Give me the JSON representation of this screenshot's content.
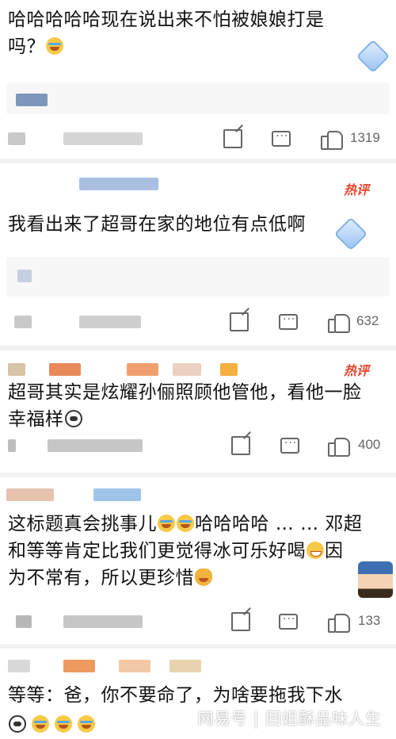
{
  "comments": [
    {
      "text": "哈哈哈哈哈现在说出来不怕被娘娘打是吗？",
      "likes": "1319",
      "hot_badge": ""
    },
    {
      "text": "我看出来了超哥在家的地位有点低啊",
      "likes": "632",
      "hot_badge": "热评"
    },
    {
      "text_line1": "超哥其实是炫耀孙俪照顾他管他，看他一脸",
      "text_line2": "幸福样",
      "likes": "400",
      "hot_badge": "热评"
    },
    {
      "text_line1_a": "这标题真会挑事儿",
      "text_line1_b": "哈哈哈哈 … … 邓超",
      "text_line2": "和等等肯定比我们更觉得冰可乐好喝",
      "text_line2_b": "因",
      "text_line3": "为不常有，所以更珍惜",
      "likes": "133"
    },
    {
      "text": "等等：爸，你不要命了，为啥要拖我下水"
    }
  ],
  "icons": {
    "share": "share-icon",
    "comment": "comment-icon",
    "like": "thumbs-up-icon",
    "vip": "diamond-badge-icon"
  },
  "colors": {
    "hot_badge": "#e8452c",
    "divider": "#f2f2f2",
    "icon_gray": "#666666"
  },
  "watermark": "网易号 | 回姐酥品味人生"
}
